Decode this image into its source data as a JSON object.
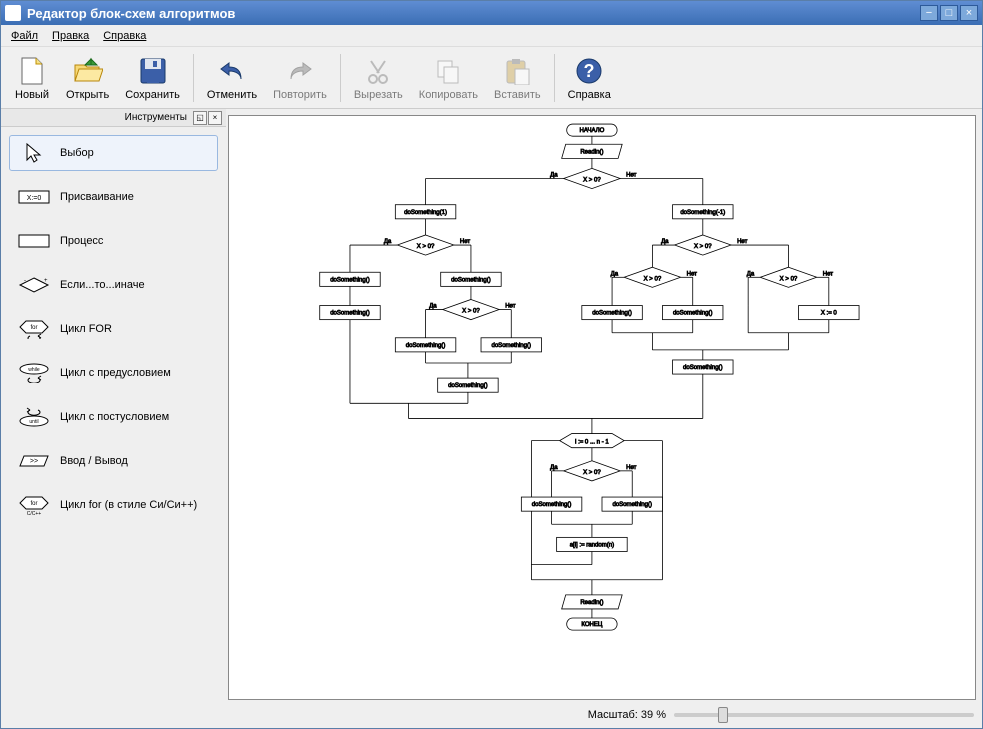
{
  "title": "Редактор блок-схем алгоритмов",
  "menus": {
    "file": "Файл",
    "edit": "Правка",
    "help": "Справка"
  },
  "toolbar": {
    "new": "Новый",
    "open": "Открыть",
    "save": "Сохранить",
    "undo": "Отменить",
    "redo": "Повторить",
    "cut": "Вырезать",
    "copy": "Копировать",
    "paste": "Вставить",
    "helpBtn": "Справка"
  },
  "tools": {
    "panelTitle": "Инструменты",
    "items": [
      {
        "label": "Выбор"
      },
      {
        "label": "Присваивание"
      },
      {
        "label": "Процесс"
      },
      {
        "label": "Если...то...иначе"
      },
      {
        "label": "Цикл FOR"
      },
      {
        "label": "Цикл с предусловием"
      },
      {
        "label": "Цикл с постусловием"
      },
      {
        "label": "Ввод / Вывод"
      },
      {
        "label": "Цикл for (в стиле Си/Си++)"
      }
    ]
  },
  "flowchart": {
    "nodes": {
      "start": "НАЧАЛО",
      "readln": "Readln()",
      "cond1": "X > 0?",
      "yes": "Да",
      "no": "Нет",
      "doSomething1": "doSomething(1)",
      "doSomethingM1": "doSomething(-1)",
      "cond2L": "X > 0?",
      "cond2R": "X > 0?",
      "doSomethingA": "doSomething()",
      "doSomethingB": "doSomething()",
      "doSomethingC": "doSomething()",
      "cond3": "X > 0?",
      "cond4L": "X > 0?",
      "cond4R": "X > 0?",
      "xassign": "X := 0",
      "forhead": "i := 0 ... n - 1",
      "cond5": "X > 0?",
      "arrayAssign": "a[i] := random(n)",
      "readln2": "Readln()",
      "end": "КОНЕЦ"
    }
  },
  "status": {
    "zoomLabel": "Масштаб: 39 %",
    "zoomValue": 39
  }
}
